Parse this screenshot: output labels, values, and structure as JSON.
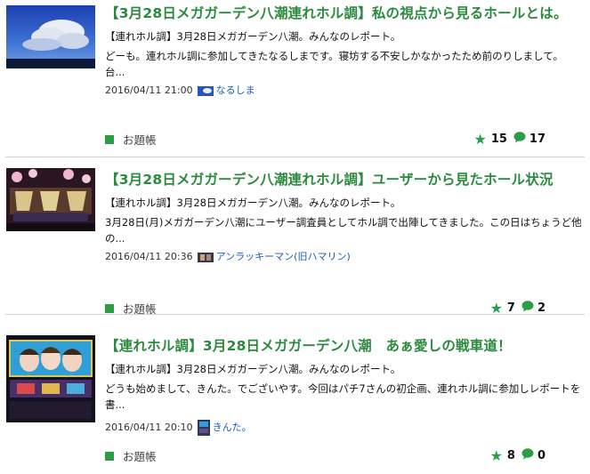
{
  "colors": {
    "title": "#2b8a3e",
    "category_square": "#2a9d46",
    "star": "#2a9d46",
    "bubble": "#2a9d46",
    "author_link": "#1a5fb4"
  },
  "posts": [
    {
      "title": "【3月28日メガガーデン八潮連れホル調】私の視点から見るホールとは。",
      "lead": "【連れホル調】3月28日メガガーデン八潮。みんなのレポート。",
      "excerpt": "どーも。連れホル調に参加してきたなるしまです。寝坊する不安しかなかったため前のりしまして。台...",
      "date": "2016/04/11 21:00",
      "author": "なるしま",
      "category": "お題帳",
      "likes": "15",
      "comments": "17"
    },
    {
      "title": "【3月28日メガガーデン八潮連れホル調】ユーザーから見たホール状況",
      "lead": "【連れホル調】3月28日メガガーデン八潮。みんなのレポート。",
      "excerpt": "3月28日(月)メガガーデン八潮にユーザー調査員としてホル調で出陣してきました。この日はちょうど他の...",
      "date": "2016/04/11 20:36",
      "author": "アンラッキーマン(旧ハマリン)",
      "category": "お題帳",
      "likes": "7",
      "comments": "2"
    },
    {
      "title": "【連れホル調】3月28日メガガーデン八潮　あぁ愛しの戦車道！",
      "lead": "【連れホル調】3月28日メガガーデン八潮。みんなのレポート。",
      "excerpt": "どうも始めまして、きんた。でございやす。今回はパチ7さんの初企画、連れホル調に参加しレポートを書...",
      "date": "2016/04/11 20:10",
      "author": "きんた。",
      "category": "お題帳",
      "likes": "8",
      "comments": "0"
    }
  ]
}
